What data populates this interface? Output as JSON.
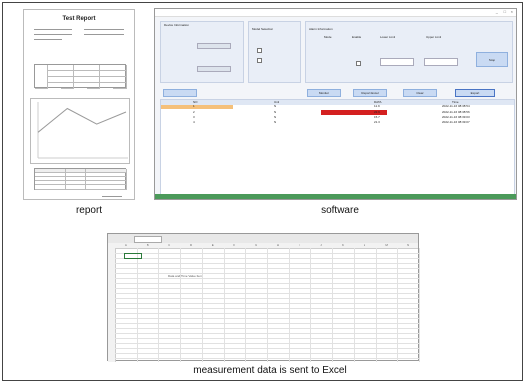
{
  "captions": {
    "report": "report",
    "software": "software",
    "excel": "measurement data is sent to Excel"
  },
  "report": {
    "title": "Test Report",
    "columns": [
      "NO",
      "Unit",
      "DATA"
    ]
  },
  "software": {
    "device_label": "Device Information",
    "model_label": "Model Selection",
    "alarm_label": "Alarm Information",
    "alarm_cols": [
      "Mode",
      "Enable",
      "Lower Limit",
      "Upper Limit"
    ],
    "buttons": [
      "Stop",
      "Monitor",
      "Report Excel",
      "Clear",
      "Export"
    ],
    "table_cols": [
      "NO",
      "Unit",
      "DATA",
      "Time"
    ],
    "rows": [
      {
        "no": "1",
        "unit": "N",
        "data": "11.9",
        "time": "2022-11-16 08:38:54"
      },
      {
        "no": "2",
        "unit": "N",
        "data": "22.9",
        "time": "2022-11-16 08:38:56"
      },
      {
        "no": "3",
        "unit": "N",
        "data": "15.7",
        "time": "2022-11-16 08:39:03"
      },
      {
        "no": "4",
        "unit": "N",
        "data": "21.3",
        "time": "2022-11-16 08:39:07"
      }
    ]
  },
  "excel": {
    "columns": [
      "A",
      "B",
      "C",
      "D",
      "E",
      "F",
      "G",
      "H",
      "I",
      "J",
      "K",
      "L",
      "M",
      "N"
    ],
    "header_label": "Data and Time Value Item"
  },
  "colors": {
    "alarm_red": "#d42020",
    "selected_orange": "#f5c07a",
    "status_green": "#4b9a5a",
    "chart_line": "#9a9a9a"
  }
}
